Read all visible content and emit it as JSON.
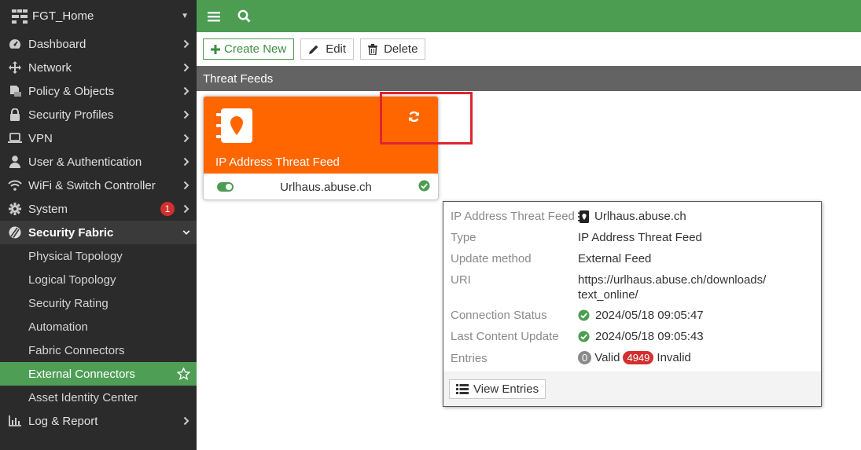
{
  "sidebar": {
    "device": "FGT_Home",
    "items": [
      {
        "label": "Dashboard",
        "icon": "dashboard-icon"
      },
      {
        "label": "Network",
        "icon": "network-icon"
      },
      {
        "label": "Policy & Objects",
        "icon": "policy-icon"
      },
      {
        "label": "Security Profiles",
        "icon": "lock-icon"
      },
      {
        "label": "VPN",
        "icon": "laptop-icon"
      },
      {
        "label": "User & Authentication",
        "icon": "user-icon"
      },
      {
        "label": "WiFi & Switch Controller",
        "icon": "wifi-icon"
      },
      {
        "label": "System",
        "icon": "gear-icon",
        "badge": "1"
      },
      {
        "label": "Security Fabric",
        "icon": "fabric-icon"
      },
      {
        "label": "Log & Report",
        "icon": "chart-icon"
      }
    ],
    "fabric_sub": [
      "Physical Topology",
      "Logical Topology",
      "Security Rating",
      "Automation",
      "Fabric Connectors",
      "External Connectors",
      "Asset Identity Center"
    ]
  },
  "toolbar": {
    "create_label": "Create New",
    "edit_label": "Edit",
    "delete_label": "Delete"
  },
  "section_title": "Threat Feeds",
  "card": {
    "title": "IP Address Threat Feed",
    "name": "Urlhaus.abuse.ch",
    "enabled": true,
    "accent": "#ff6600"
  },
  "tooltip": {
    "feed_key": "IP Address Threat Feed",
    "feed_value": "Urlhaus.abuse.ch",
    "type_key": "Type",
    "type_value": "IP Address Threat Feed",
    "method_key": "Update method",
    "method_value": "External Feed",
    "uri_key": "URI",
    "uri_line1": "https://urlhaus.abuse.ch/downloads/",
    "uri_line2": "text_online/",
    "conn_key": "Connection Status",
    "conn_value": "2024/05/18 09:05:47",
    "last_key": "Last Content Update",
    "last_value": "2024/05/18 09:05:43",
    "entries_key": "Entries",
    "valid_count": "0",
    "valid_label": "Valid",
    "invalid_count": "4949",
    "invalid_label": "Invalid",
    "view_entries_label": "View Entries"
  },
  "colors": {
    "brand_green": "#4c9d52",
    "sidebar_bg": "#2b2b2b",
    "card_orange": "#ff6600",
    "highlight_red": "#e0242f"
  }
}
